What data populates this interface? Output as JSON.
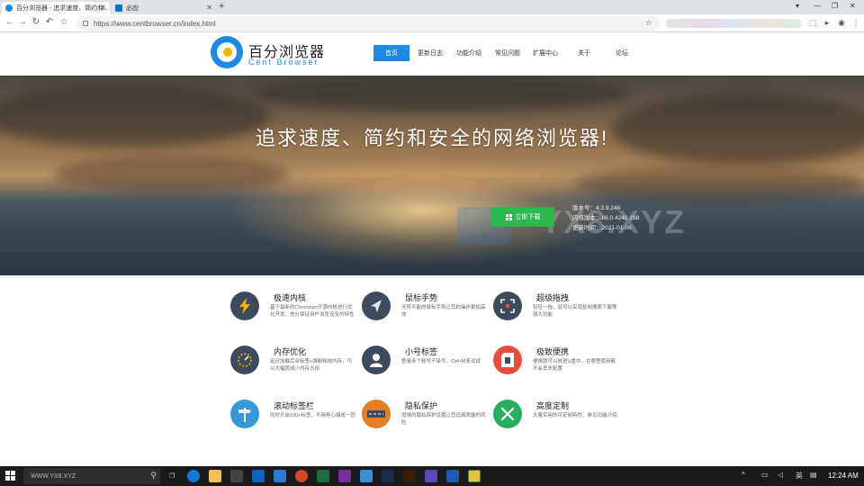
{
  "browser": {
    "tabs": [
      {
        "title": "百分浏览器 - 追求速度、简约和...",
        "active": true
      },
      {
        "title": "必应",
        "active": false
      }
    ],
    "new_tab_symbol": "+",
    "url": "https://www.centbrowser.cn/index.html",
    "nav_icons": [
      "back-icon",
      "forward-icon",
      "reload-icon",
      "undo-icon",
      "star-icon"
    ]
  },
  "site": {
    "logo_cn": "百分浏览器",
    "logo_en": "Cent Browser",
    "nav": [
      {
        "label": "首页",
        "active": true
      },
      {
        "label": "更新日志"
      },
      {
        "label": "功能介绍"
      },
      {
        "label": "常见问题"
      },
      {
        "label": "扩展中心"
      },
      {
        "label": "关于"
      },
      {
        "label": "论坛"
      }
    ]
  },
  "hero": {
    "title": "追求速度、简约和安全的网络浏览器!",
    "download_label": "立即下载",
    "version_line": "版本号：4.3.9.248",
    "kernel_line": "内核版本：86.0.4240.198",
    "date_line": "更新时间：2021-01-06",
    "watermark": "YX8.XYZ"
  },
  "features": [
    {
      "title": "极速内核",
      "desc": "基于最新的Chromium开源内核进行优化开发，充分保证用户浏览安全的特性",
      "icon": "lightning-icon",
      "color": "#3d4b5c"
    },
    {
      "title": "鼠标手势",
      "desc": "无所不能的鼠标手势让您的操作更加高效",
      "icon": "cursor-icon",
      "color": "#3d4b5c"
    },
    {
      "title": "超级拖拽",
      "desc": "轻轻一拖，就可以实现复制搜索下载等强大功能",
      "icon": "drag-icon",
      "color": "#3d4b5c"
    },
    {
      "title": "内存优化",
      "desc": "延迟加载后台标签+强制释放内存，可以大幅度减少内存占用",
      "icon": "gauge-icon",
      "color": "#3d4b5c"
    },
    {
      "title": "小号标签",
      "desc": "登录多个账号不串号，Ctrl+M来试试",
      "icon": "user-icon",
      "color": "#3d4b5c"
    },
    {
      "title": "极致便携",
      "desc": "便携版可以放进U盘中，在哪里使用都不会丢失配置",
      "icon": "sdcard-icon",
      "color": "#e74c3c"
    },
    {
      "title": "滚动标签栏",
      "desc": "同时开启100+标签，不用担心缩成一团",
      "icon": "signpost-icon",
      "color": "#3498db"
    },
    {
      "title": "隐私保护",
      "desc": "增强的隐私保护设置让您远离泄露的风险",
      "icon": "road-icon",
      "color": "#e67e22"
    },
    {
      "title": "高度定制",
      "desc": "大量实用的可定制特性，参见功能介绍",
      "icon": "tools-icon",
      "color": "#27ae60"
    }
  ],
  "taskbar": {
    "search_placeholder": "WWW.YX8.XYZ",
    "clock": "12:24 AM"
  }
}
